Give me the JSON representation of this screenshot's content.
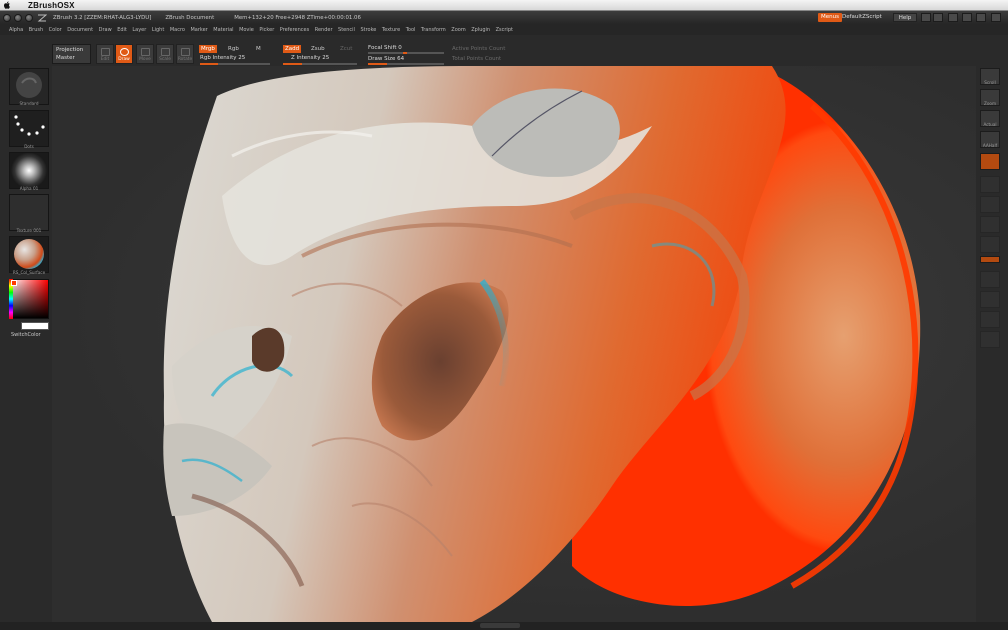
{
  "mac_menubar": {
    "app_name": "ZBrushOSX",
    "apple_icon": "apple-icon"
  },
  "titlebar": {
    "app_title": "ZBrush 3.2 [ZZEM:RHAT-ALG3-LYDU]",
    "document_title": "ZBrush Document",
    "stats": "Mem+132+20  Free+2948  ZTime+00:00:01.06",
    "menus_label": "Menus",
    "script_label": "DefaultZScript",
    "help_label": "Help"
  },
  "main_menu": [
    "Alpha",
    "Brush",
    "Color",
    "Document",
    "Draw",
    "Edit",
    "Layer",
    "Light",
    "Macro",
    "Marker",
    "Material",
    "Movie",
    "Picker",
    "Preferences",
    "Render",
    "Stencil",
    "Stroke",
    "Texture",
    "Tool",
    "Transform",
    "Zoom",
    "Zplugin",
    "Zscript"
  ],
  "toolbar": {
    "projection_label": "Projection",
    "master_label": "Master",
    "tools": [
      "Edit",
      "Draw",
      "Move",
      "Scale",
      "Rotate"
    ],
    "active_tool": "Draw",
    "mrgb": "Mrgb",
    "rgb": "Rgb",
    "m": "M",
    "rgb_intensity": "Rgb Intensity 25",
    "zadd": "Zadd",
    "zsub": "Zsub",
    "zcut": "Zcut",
    "z_intensity": "Z Intensity 25",
    "focal_shift": "Focal Shift 0",
    "draw_size": "Draw Size 64",
    "active_points": "Active Points Count",
    "total_points": "Total Points Count",
    "rgb_intensity_level": 0.25,
    "z_intensity_level": 0.25,
    "draw_size_level": 0.25
  },
  "left_panel": {
    "material_label": "Standard",
    "stroke_label": "Dots",
    "alpha_label": "Alpha 01",
    "texture_label": "Texture 001",
    "matcap_label": "RS_Col_Surface",
    "switch_color": "SwitchColor"
  },
  "right_panel": {
    "buttons": [
      "Scroll",
      "Zoom",
      "Actual",
      "AAHalf",
      "",
      "",
      "",
      "",
      "",
      "",
      "",
      "",
      "",
      "",
      ""
    ]
  },
  "colors": {
    "accent": "#e05a16",
    "background": "#2b2b2b",
    "sculpt_light": "#d8d2c8",
    "sculpt_rim": "#ff4a10",
    "shadow_cyan": "#2ab0d0"
  }
}
